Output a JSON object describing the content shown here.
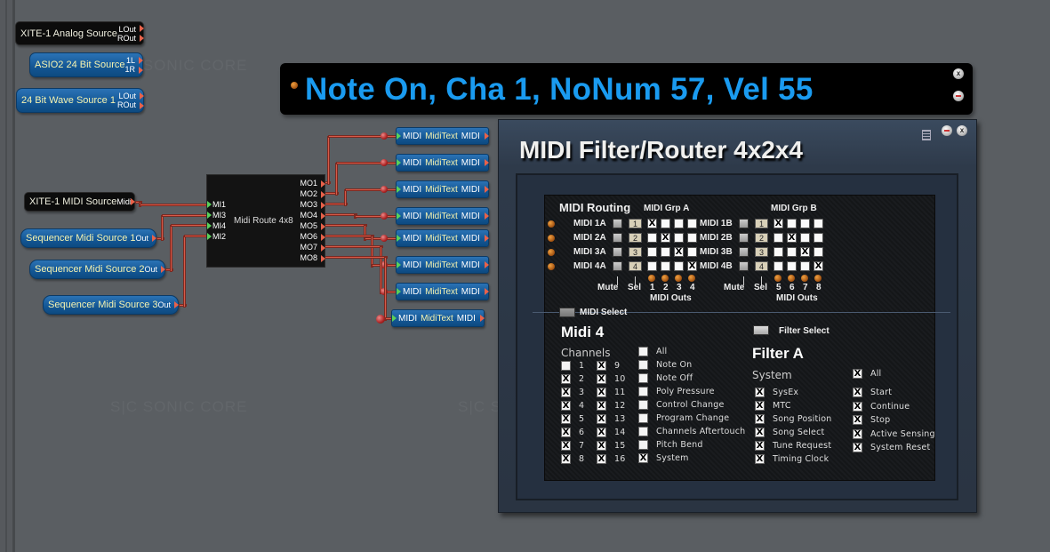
{
  "watermark": "S|C  SONIC CORE",
  "modules": {
    "analog": {
      "name": "XITE-1 Analog Source",
      "ports": [
        "LOut",
        "ROut"
      ]
    },
    "asio": {
      "name": "ASIO2 24 Bit Source",
      "ports": [
        "1L",
        "1R"
      ]
    },
    "wave": {
      "name": "24 Bit Wave Source 1",
      "ports": [
        "LOut",
        "ROut"
      ]
    },
    "midi_src": {
      "name": "XITE-1 MIDI Source",
      "port": "Midi"
    },
    "seq1": {
      "name": "Sequencer Midi Source 1",
      "port": "Out"
    },
    "seq2": {
      "name": "Sequencer Midi Source 2",
      "port": "Out"
    },
    "seq3": {
      "name": "Sequencer Midi Source 3",
      "port": "Out"
    },
    "router": {
      "name": "Midi Route 4x8",
      "inputs": [
        "MI1",
        "MI3",
        "MI4",
        "MI2"
      ],
      "outputs": [
        "MO1",
        "MO2",
        "MO3",
        "MO4",
        "MO5",
        "MO6",
        "MO7",
        "MO8"
      ]
    },
    "miditext": {
      "in": "MIDI",
      "name": "MidiText",
      "out": "MIDI",
      "count": 8
    }
  },
  "note_window": {
    "text": "Note On, Cha 1, NoNum 57, Vel 55"
  },
  "panel": {
    "title": "MIDI Filter/Router 4x2x4",
    "routing_label": "MIDI Routing",
    "grp_a_label": "MIDI Grp A",
    "grp_b_label": "MIDI Grp B",
    "rows_a": [
      {
        "label": "MIDI 1A",
        "sel": "1",
        "outs": [
          true,
          false,
          false,
          false
        ]
      },
      {
        "label": "MIDI 2A",
        "sel": "2",
        "outs": [
          false,
          true,
          false,
          false
        ]
      },
      {
        "label": "MIDI 3A",
        "sel": "3",
        "outs": [
          false,
          false,
          true,
          false
        ]
      },
      {
        "label": "MIDI 4A",
        "sel": "4",
        "outs": [
          false,
          false,
          false,
          true
        ]
      }
    ],
    "rows_b": [
      {
        "label": "MIDI 1B",
        "sel": "1",
        "outs": [
          true,
          false,
          false,
          false
        ]
      },
      {
        "label": "MIDI 2B",
        "sel": "2",
        "outs": [
          false,
          true,
          false,
          false
        ]
      },
      {
        "label": "MIDI 3B",
        "sel": "3",
        "outs": [
          false,
          false,
          true,
          false
        ]
      },
      {
        "label": "MIDI 4B",
        "sel": "4",
        "outs": [
          false,
          false,
          false,
          true
        ]
      }
    ],
    "mute_label": "Mute",
    "sel_label": "Sel",
    "outs_a": [
      "1",
      "2",
      "3",
      "4"
    ],
    "outs_b": [
      "5",
      "6",
      "7",
      "8"
    ],
    "midi_outs_label": "MIDI Outs",
    "midi_select_label": "MIDI Select",
    "midi_heading": "Midi 4",
    "channels_label": "Channels",
    "channels": [
      {
        "n": "1",
        "on": false
      },
      {
        "n": "2",
        "on": true
      },
      {
        "n": "3",
        "on": true
      },
      {
        "n": "4",
        "on": true
      },
      {
        "n": "5",
        "on": true
      },
      {
        "n": "6",
        "on": true
      },
      {
        "n": "7",
        "on": true
      },
      {
        "n": "8",
        "on": true
      },
      {
        "n": "9",
        "on": true
      },
      {
        "n": "10",
        "on": true
      },
      {
        "n": "11",
        "on": true
      },
      {
        "n": "12",
        "on": true
      },
      {
        "n": "13",
        "on": true
      },
      {
        "n": "14",
        "on": true
      },
      {
        "n": "15",
        "on": true
      },
      {
        "n": "16",
        "on": true
      }
    ],
    "msg_types": [
      {
        "label": "All",
        "on": false
      },
      {
        "label": "Note On",
        "on": false
      },
      {
        "label": "Note Off",
        "on": false
      },
      {
        "label": "Poly Pressure",
        "on": false
      },
      {
        "label": "Control Change",
        "on": false
      },
      {
        "label": "Program Change",
        "on": false
      },
      {
        "label": "Channels Aftertouch",
        "on": false
      },
      {
        "label": "Pitch Bend",
        "on": false
      },
      {
        "label": "System",
        "on": true
      }
    ],
    "filter_select_label": "Filter Select",
    "filter_heading": "Filter A",
    "system_label": "System",
    "system_all": {
      "label": "All",
      "on": true
    },
    "system_left": [
      {
        "label": "SysEx",
        "on": true
      },
      {
        "label": "MTC",
        "on": true
      },
      {
        "label": "Song Position",
        "on": true
      },
      {
        "label": "Song Select",
        "on": true
      },
      {
        "label": "Tune Request",
        "on": true
      },
      {
        "label": "Timing Clock",
        "on": true
      }
    ],
    "system_right": [
      {
        "label": "Start",
        "on": true
      },
      {
        "label": "Continue",
        "on": true
      },
      {
        "label": "Stop",
        "on": true
      },
      {
        "label": "Active Sensing",
        "on": true
      },
      {
        "label": "System Reset",
        "on": true
      }
    ],
    "check_mark": "X"
  }
}
